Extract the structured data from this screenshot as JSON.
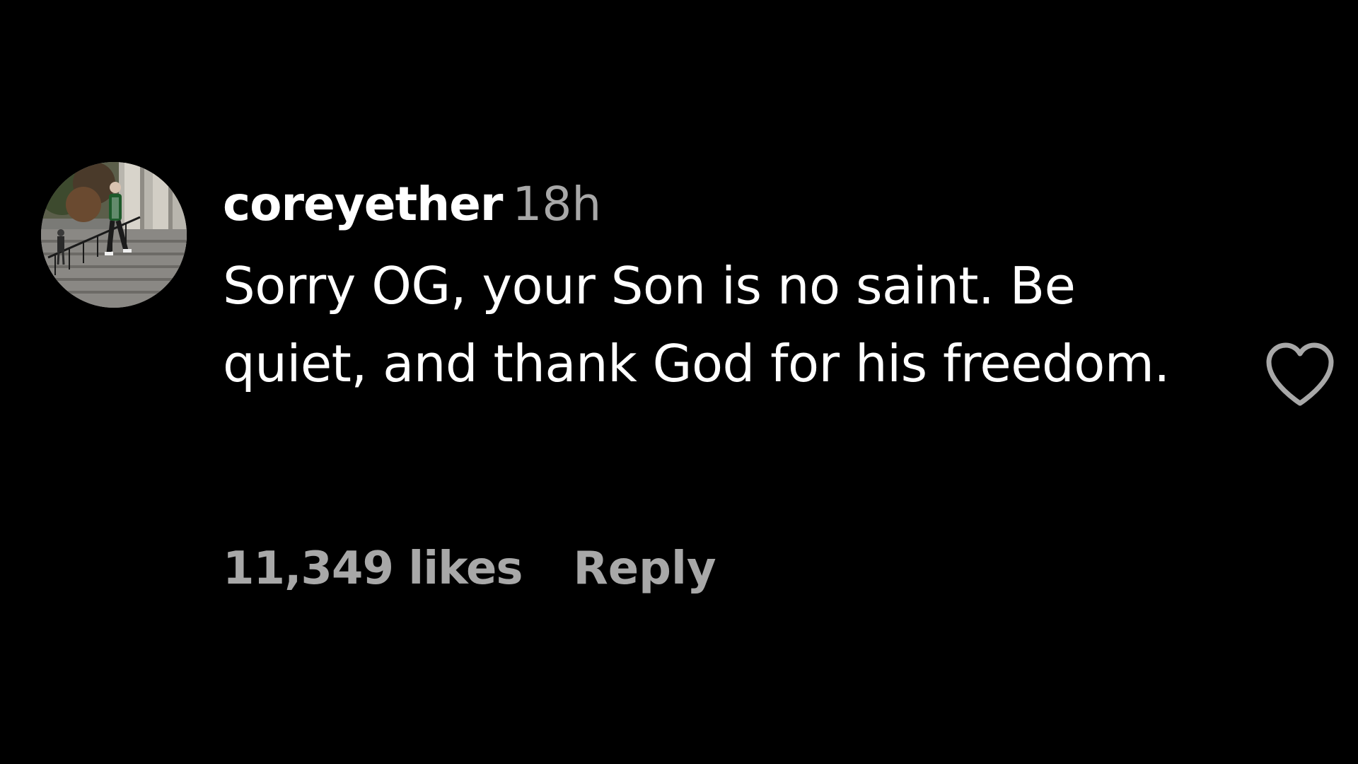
{
  "comment": {
    "username": "coreyether",
    "timestamp": "18h",
    "text": "Sorry OG, your Son is no saint. Be quiet, and thank God for his freedom.",
    "likes": "11,349 likes",
    "reply_label": "Reply",
    "avatar_icon": "user-photo",
    "like_icon": "heart-outline-icon"
  },
  "colors": {
    "background": "#000000",
    "primary_text": "#ffffff",
    "secondary_text": "#a8a8a8"
  }
}
